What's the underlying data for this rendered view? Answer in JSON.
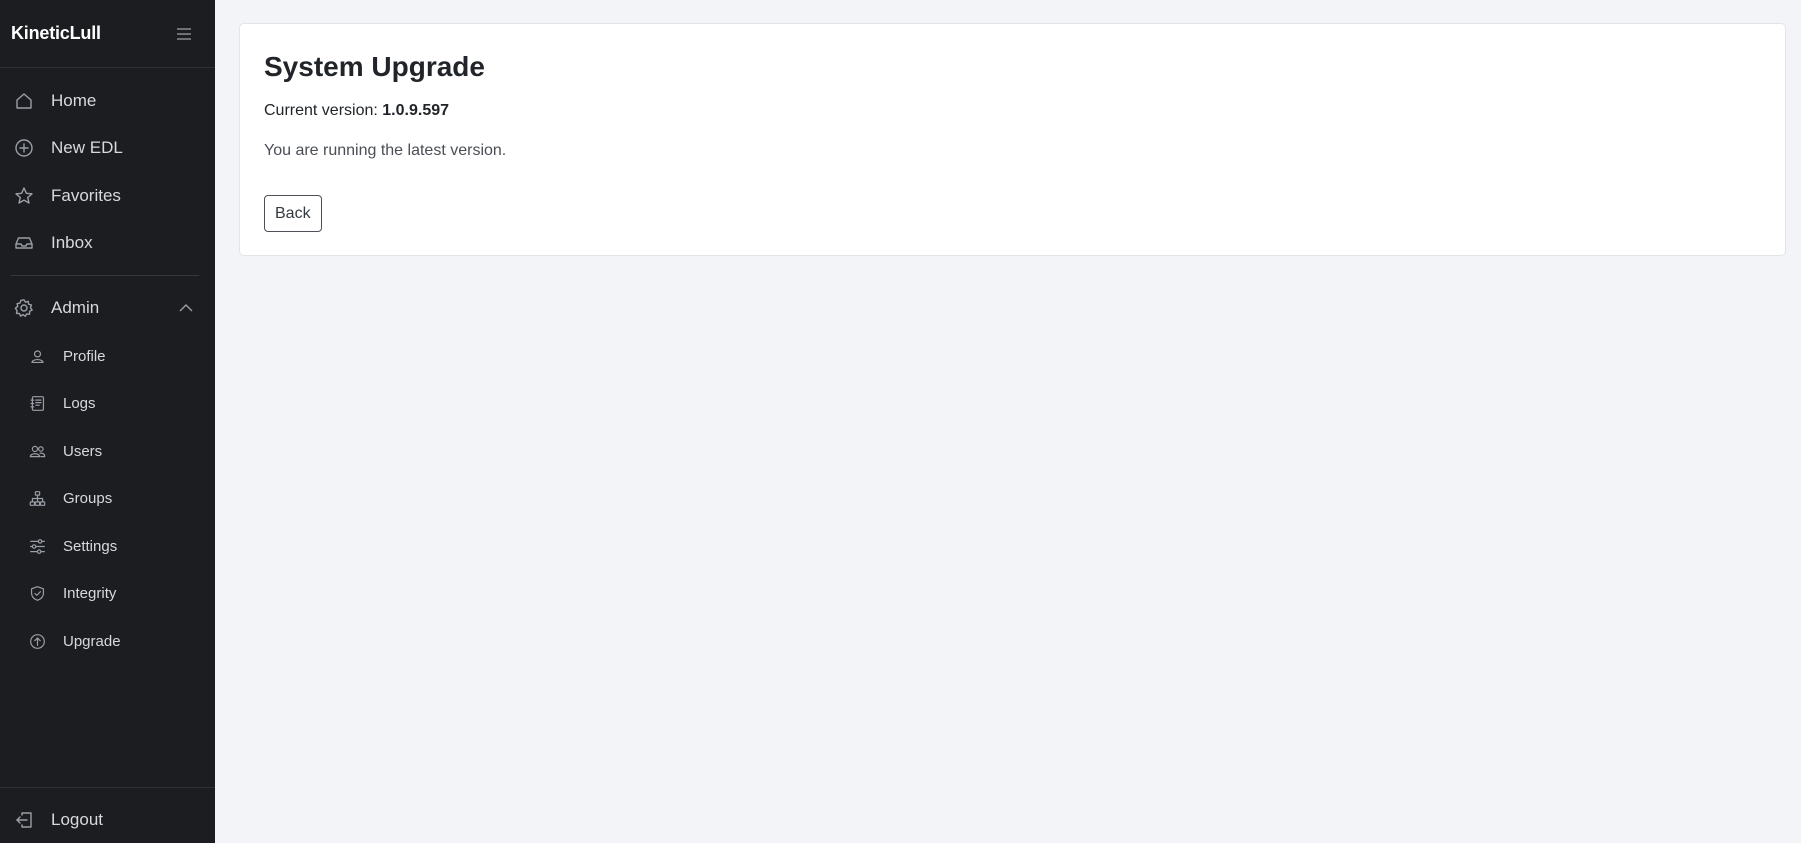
{
  "app": {
    "brand": "KineticLull"
  },
  "sidebar": {
    "main_items": [
      {
        "label": "Home",
        "icon": "home-icon"
      },
      {
        "label": "New EDL",
        "icon": "plus-circle-icon"
      },
      {
        "label": "Favorites",
        "icon": "star-icon"
      },
      {
        "label": "Inbox",
        "icon": "inbox-icon"
      }
    ],
    "admin": {
      "label": "Admin",
      "icon": "gear-icon",
      "expanded": true,
      "items": [
        {
          "label": "Profile",
          "icon": "person-icon"
        },
        {
          "label": "Logs",
          "icon": "journal-icon"
        },
        {
          "label": "Users",
          "icon": "people-icon"
        },
        {
          "label": "Groups",
          "icon": "diagram-icon"
        },
        {
          "label": "Settings",
          "icon": "sliders-icon"
        },
        {
          "label": "Integrity",
          "icon": "shield-check-icon"
        },
        {
          "label": "Upgrade",
          "icon": "arrow-up-circle-icon"
        }
      ]
    },
    "logout": {
      "label": "Logout",
      "icon": "box-arrow-left-icon"
    }
  },
  "main": {
    "title": "System Upgrade",
    "current_version_label": "Current version:",
    "current_version": "1.0.9.597",
    "status_message": "You are running the latest version.",
    "back_label": "Back"
  }
}
